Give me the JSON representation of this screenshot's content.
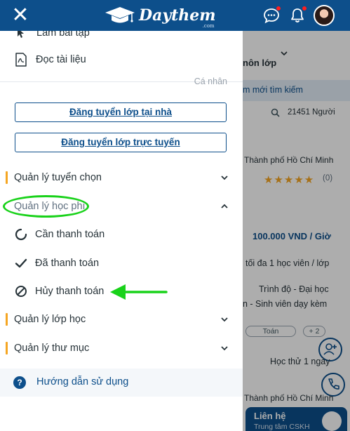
{
  "header": {
    "logo_text": "Daythem",
    "logo_sub": ".com"
  },
  "drawer": {
    "top_partial_label": "Làm bài tập",
    "read_docs_label": "Đọc tài liệu",
    "section_personal": "Cá nhân",
    "btn_post_home": "Đăng tuyển lớp tại nhà",
    "btn_post_online": "Đăng tuyển lớp trực tuyến",
    "menu": {
      "selection": "Quản lý tuyển chọn",
      "tuition": "Quản lý học phí",
      "tuition_sub": {
        "pending": "Cần thanh toán",
        "paid": "Đã thanh toán",
        "cancelled": "Hủy thanh toán"
      },
      "classes": "Quản lý lớp học",
      "folders": "Quản lý thư mục"
    },
    "help_label": "Hướng dẫn sử dụng"
  },
  "background_page": {
    "class_suffix": "nôn lớp",
    "band_text": "m mới tìm kiếm",
    "people_count": "21451 Người",
    "city_1": "Thành phố Hồ Chí Minh",
    "rating": "(0)",
    "price": "100.000 VND / Giờ",
    "max_students": "tối đa 1 học viên / lớp",
    "level_1": "Trình độ - Đại học",
    "level_2": "n - Sinh viên dạy kèm",
    "tag_1": "Toán",
    "tag_2": "+ 2",
    "trial": "Học thử 1 ngày",
    "city_2": "Thành phố Hồ Chí Minh",
    "contact_title": "Liên hệ",
    "contact_sub": "Trung tâm CSKH"
  },
  "colors": {
    "brand": "#0d4f8b",
    "accent": "#f5a623",
    "annotation": "#19d21a",
    "notif": "#ff1e1e"
  },
  "icons": [
    "close-icon",
    "graduation-cap-icon",
    "chat-icon",
    "bell-icon",
    "pdf-icon",
    "chevron-down-icon",
    "chevron-up-icon",
    "spinner-icon",
    "check-icon",
    "ban-icon",
    "help-icon",
    "search-icon",
    "add-user-icon",
    "phone-icon",
    "headset-icon"
  ]
}
